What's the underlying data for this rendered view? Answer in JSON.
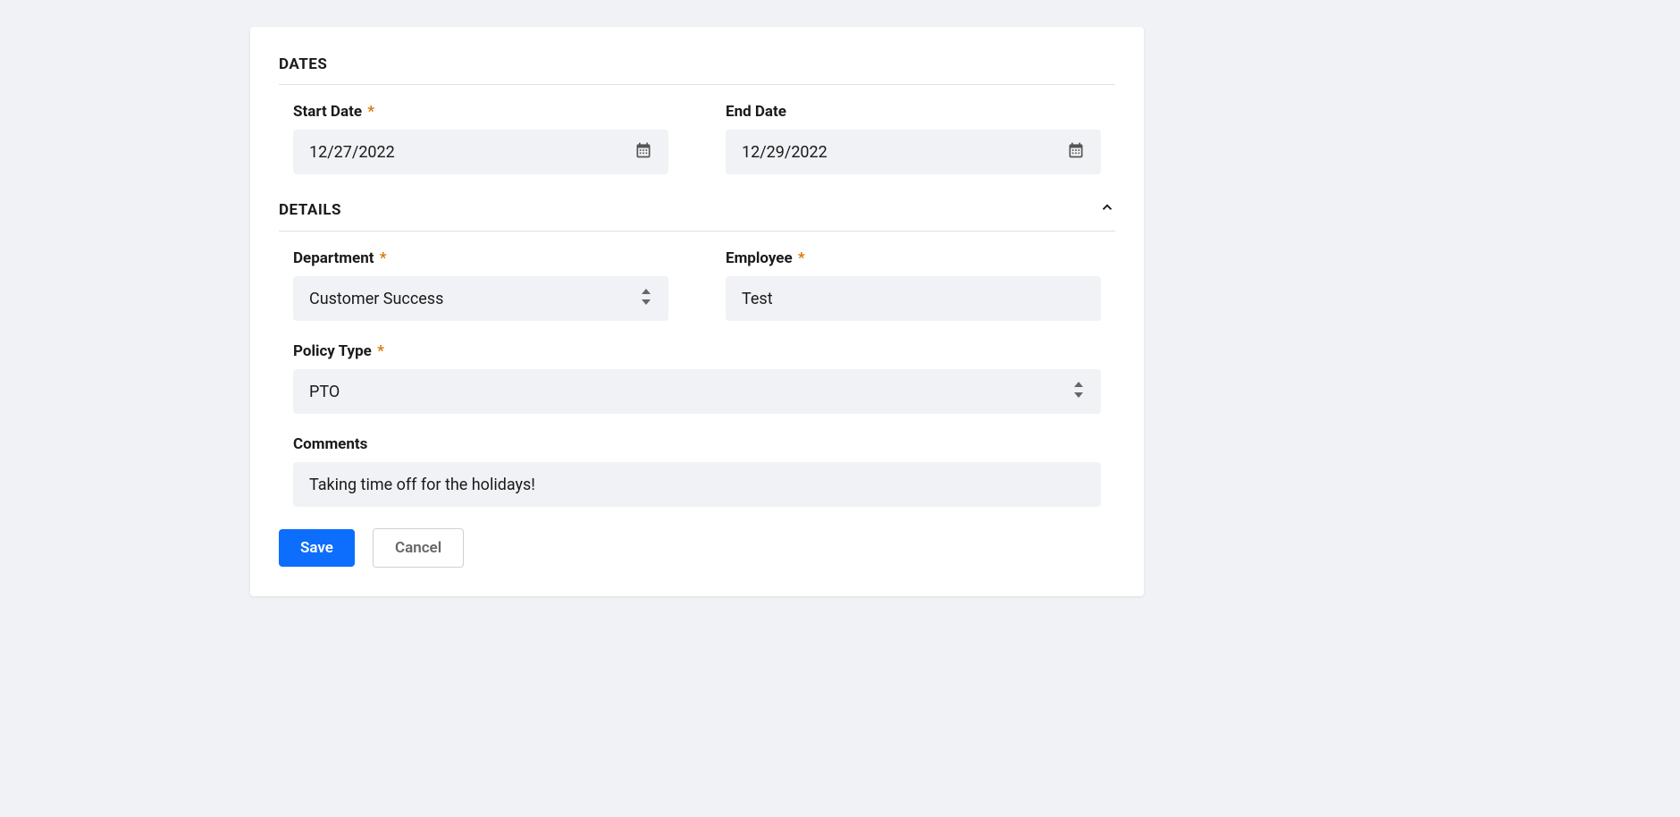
{
  "sections": {
    "dates": {
      "title": "DATES",
      "start_date": {
        "label": "Start Date",
        "value": "12/27/2022",
        "required": true
      },
      "end_date": {
        "label": "End Date",
        "value": "12/29/2022",
        "required": false
      }
    },
    "details": {
      "title": "DETAILS",
      "department": {
        "label": "Department",
        "value": "Customer Success",
        "required": true
      },
      "employee": {
        "label": "Employee",
        "value": "Test",
        "required": true
      },
      "policy_type": {
        "label": "Policy Type",
        "value": "PTO",
        "required": true
      },
      "comments": {
        "label": "Comments",
        "value": "Taking time off for the holidays!",
        "required": false
      }
    }
  },
  "buttons": {
    "save": "Save",
    "cancel": "Cancel"
  },
  "required_marker": "*"
}
